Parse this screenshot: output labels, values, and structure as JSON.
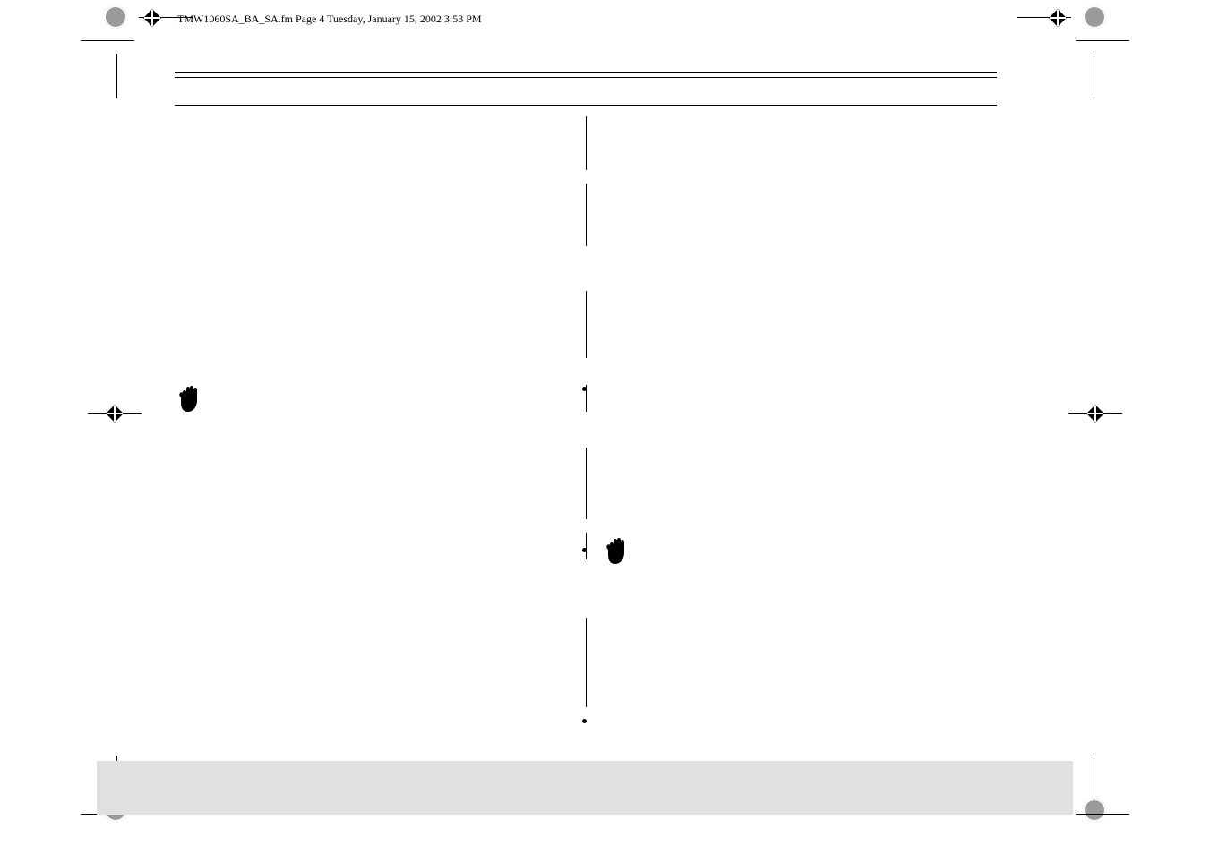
{
  "header": {
    "file_label": "TMW1060SA_BA_SA.fm  Page 4  Tuesday, January 15, 2002  3:53 PM"
  },
  "icons": {
    "left_hand": "stop-hand-icon",
    "right_hand": "stop-hand-icon"
  }
}
